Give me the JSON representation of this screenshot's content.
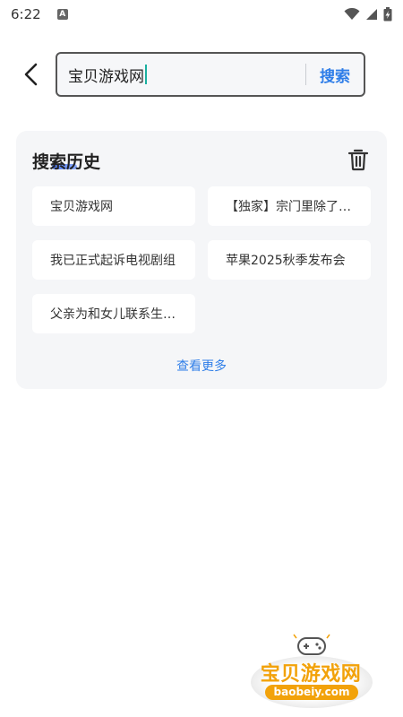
{
  "status_bar": {
    "time": "6:22",
    "notification_icon": "a-letter-icon",
    "icons": [
      "wifi-icon",
      "signal-icon",
      "battery-charging-icon"
    ]
  },
  "top_bar": {
    "back_icon": "chevron-left-icon",
    "search": {
      "value": "宝贝游戏网",
      "button_label": "搜索"
    }
  },
  "history": {
    "title": "搜索历史",
    "clear_icon": "trash-icon",
    "items": [
      {
        "label": "宝贝游戏网"
      },
      {
        "label": "【独家】宗门里除了我都是卧底"
      },
      {
        "label": "我已正式起诉电视剧组"
      },
      {
        "label": "苹果2025秋季发布会"
      },
      {
        "label": "父亲为和女儿联系生活费"
      }
    ],
    "more_label": "查看更多"
  },
  "watermark": {
    "name": "宝贝游戏网",
    "url": "baobeiy.com"
  },
  "colors": {
    "accent": "#2f7ee8",
    "card_bg": "#f5f6f8",
    "watermark": "#f2a20a"
  }
}
